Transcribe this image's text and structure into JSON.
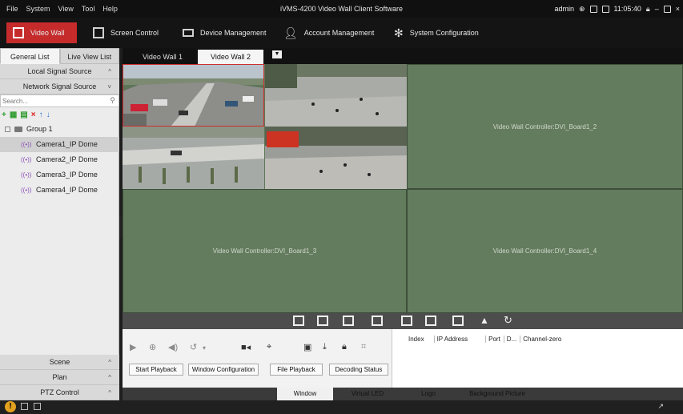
{
  "titlebar": {
    "menu": [
      "File",
      "System",
      "View",
      "Tool",
      "Help"
    ],
    "title": "iVMS-4200 Video Wall Client Software",
    "user": "admin",
    "time": "11:05:40"
  },
  "toolbar": {
    "items": [
      "Video Wall",
      "Screen Control",
      "Device Management",
      "Account Management",
      "System Configuration"
    ]
  },
  "left": {
    "tabs": [
      "General List",
      "Live View List"
    ],
    "sections": {
      "local": "Local Signal Source",
      "network": "Network Signal Source"
    },
    "search_placeholder": "Search...",
    "group": "Group 1",
    "cameras": [
      "Camera1_IP Dome",
      "Camera2_IP Dome",
      "Camera3_IP Dome",
      "Camera4_IP Dome"
    ],
    "bottom": [
      "Scene",
      "Plan",
      "PTZ Control"
    ]
  },
  "view_tabs": [
    "Video Wall 1",
    "Video Wall 2"
  ],
  "wall": {
    "cells": [
      "Video Wall Controller:DVI_Board1_2",
      "Video Wall Controller:DVI_Board1_3",
      "Video Wall Controller:DVI_Board1_4"
    ]
  },
  "playback_buttons": [
    "Start Playback",
    "Window Configuration",
    "File Playback",
    "Decoding Status"
  ],
  "grid_columns": [
    "Index",
    "IP Address",
    "Port",
    "D...",
    "Channel-zero"
  ],
  "bottom_tabs": [
    "Window",
    "Virtual LED",
    "Logo",
    "Background Picture"
  ],
  "colors": {
    "accent": "#c62b2b",
    "wall": "#647c5e",
    "camera_icon": "#8a52b8"
  }
}
